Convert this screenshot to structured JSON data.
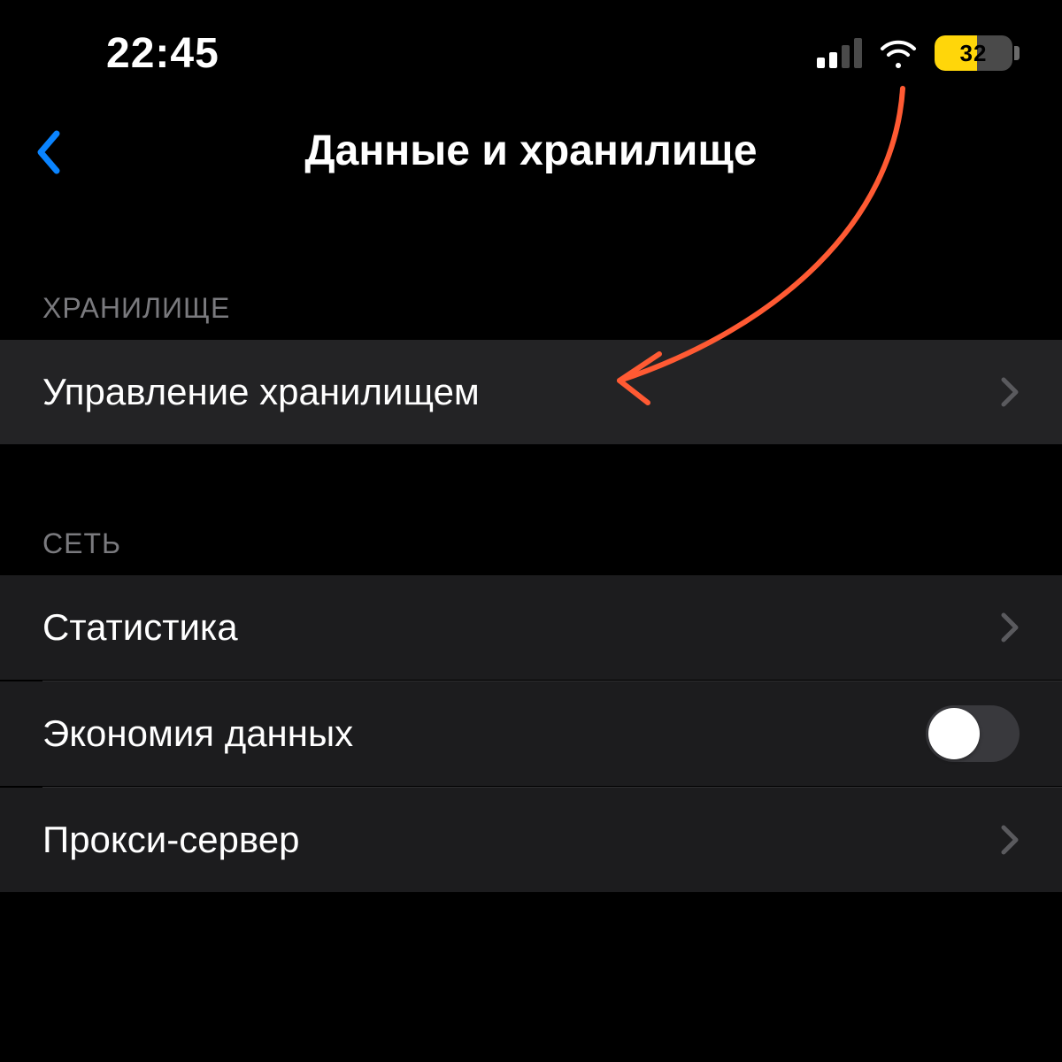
{
  "status": {
    "time": "22:45",
    "battery_level": "32"
  },
  "header": {
    "title": "Данные и хранилище"
  },
  "sections": {
    "storage": {
      "header": "ХРАНИЛИЩЕ",
      "items": [
        {
          "label": "Управление хранилищем"
        }
      ]
    },
    "network": {
      "header": "СЕТЬ",
      "items": [
        {
          "label": "Статистика"
        },
        {
          "label": "Экономия данных",
          "toggle": false
        },
        {
          "label": "Прокси-сервер"
        }
      ]
    }
  }
}
